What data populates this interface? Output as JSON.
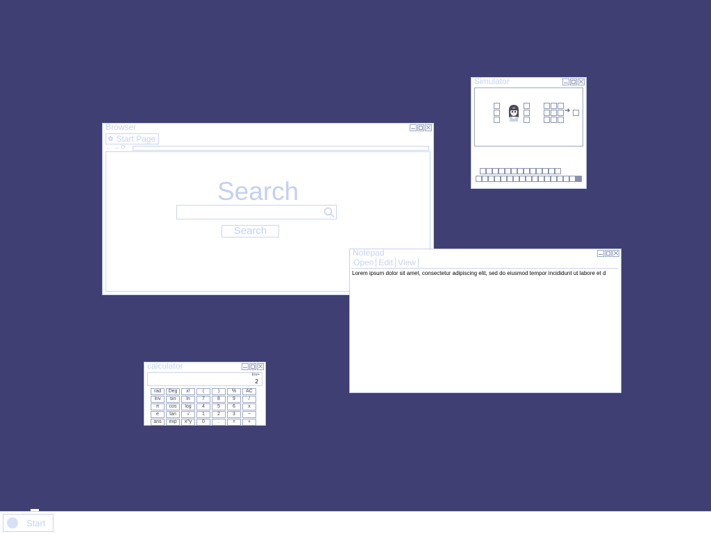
{
  "browser": {
    "title": "Browser",
    "tab_label": "Start Page",
    "nav_icons": [
      "back-arrow-icon",
      "forward-arrow-icon",
      "reload-icon"
    ],
    "search_heading": "Search",
    "search_input_value": "",
    "search_button_label": "Search"
  },
  "simulator": {
    "title": "Simulator"
  },
  "notepad": {
    "title": "Notepad",
    "menu": [
      "Open",
      "Edit",
      "View"
    ],
    "content": "Lorem ipsum dolor sit amet, consectetur adipiscing elit, sed do eiusmod tempor incididunt ut labore et d"
  },
  "calculator": {
    "title": "calculator",
    "mode": "Inv=",
    "display_value": "2",
    "keys": [
      "rad",
      "Deg",
      "x!",
      "(",
      ")",
      "%",
      "AC",
      "Inv",
      "sin",
      "ln",
      "7",
      "8",
      "9",
      "/",
      "π",
      "cos",
      "log",
      "4",
      "5",
      "6",
      "x",
      "e",
      "tan",
      "√",
      "1",
      "2",
      "3",
      "−",
      "ans",
      "exp",
      "x^y",
      "0",
      ".",
      "=",
      "+"
    ]
  },
  "taskbar": {
    "start_label": "Start"
  },
  "colors": {
    "desktop": "#403f73",
    "window_border": "#c3d0ee",
    "pale_text": "#c5d3f0"
  }
}
